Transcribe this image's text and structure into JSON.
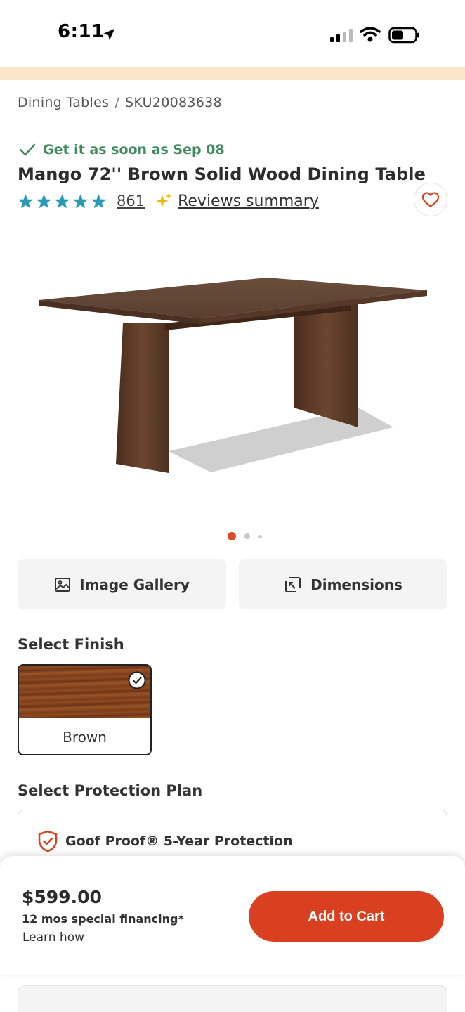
{
  "status_bar": {
    "time": "6:11"
  },
  "breadcrumb": {
    "category": "Dining Tables",
    "separator": "/",
    "sku": "SKU20083638"
  },
  "delivery": {
    "text": "Get it as soon as Sep 08",
    "color": "#3f8a5e"
  },
  "product": {
    "title": "Mango 72'' Brown Solid Wood Dining Table",
    "rating_stars": 5,
    "review_count": "861",
    "reviews_summary_label": "Reviews summary"
  },
  "carousel": {
    "total": 3,
    "active": 1
  },
  "media_buttons": {
    "gallery_label": "Image Gallery",
    "dimensions_label": "Dimensions"
  },
  "finish": {
    "heading": "Select Finish",
    "selected": "Brown"
  },
  "protection": {
    "heading": "Select Protection Plan",
    "option": "Goof Proof® 5-Year Protection"
  },
  "cart": {
    "price": "$599.00",
    "financing": "12 mos special financing*",
    "learn_how": "Learn how",
    "add_to_cart": "Add to Cart",
    "accent_color": "#d8401f"
  },
  "colors": {
    "star": "#2a9ab5",
    "promo_strip": "#fbe6c9"
  }
}
